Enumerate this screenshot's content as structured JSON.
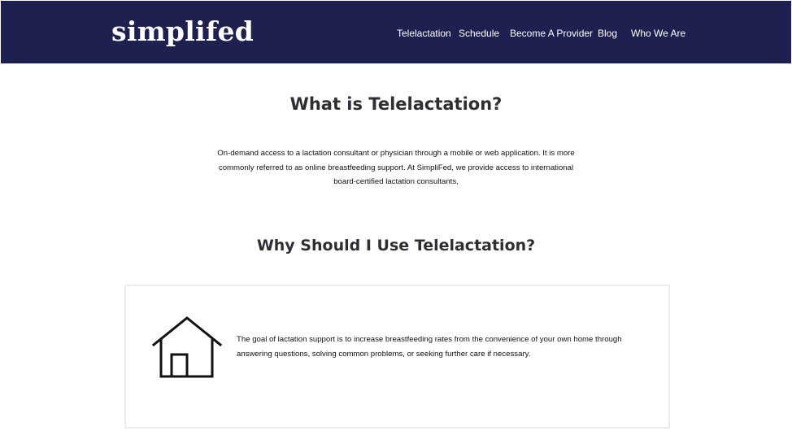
{
  "header": {
    "logo": "simplifed",
    "nav": [
      {
        "label": "Telelactation"
      },
      {
        "label": "Schedule"
      },
      {
        "label": "Become A Provider"
      },
      {
        "label": "Blog"
      },
      {
        "label": "Who We Are"
      }
    ]
  },
  "main": {
    "title": "What is Telelactation?",
    "intro": "On-demand access to a lactation consultant or physician through a mobile or web application. It is more commonly referred to as online breastfeeding support. At SimpliFed, we provide access to international board-certified lactation consultants,",
    "section_title": "Why Should I Use Telelactation?",
    "card": {
      "icon": "house-icon",
      "text": "The goal of lactation support is to increase breastfeeding rates from the convenience of your own home through answering questions, solving common problems, or seeking further care if necessary."
    }
  },
  "colors": {
    "header_bg": "#1e2050",
    "header_text": "#ffffff",
    "heading_text": "#2e2e33",
    "card_border": "#ececec"
  }
}
